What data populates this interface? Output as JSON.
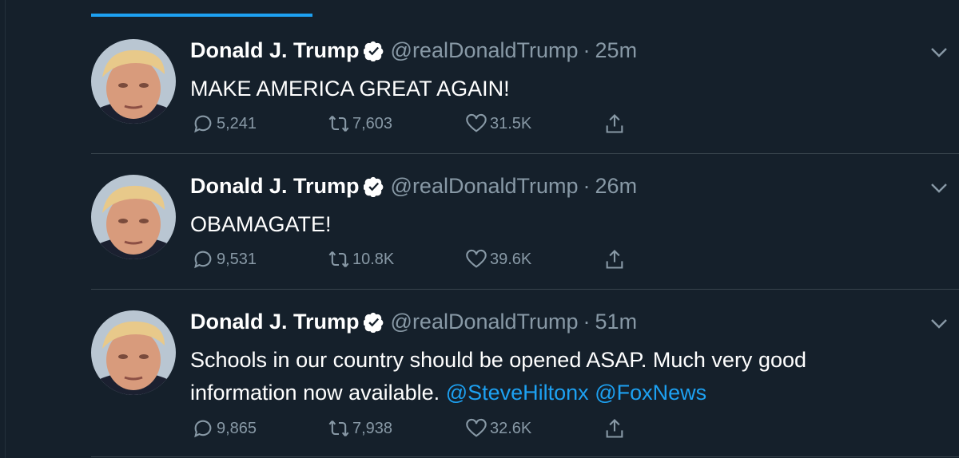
{
  "colors": {
    "background": "#15202b",
    "accent": "#1da1f2",
    "muted": "#8899a6",
    "divider": "#38444d"
  },
  "tweets": [
    {
      "name": "Donald J. Trump",
      "handle": "@realDonaldTrump",
      "separator": "·",
      "time": "25m",
      "text_parts": [
        "MAKE AMERICA GREAT AGAIN!"
      ],
      "mentions": [],
      "replies": "5,241",
      "retweets": "7,603",
      "likes": "31.5K"
    },
    {
      "name": "Donald J. Trump",
      "handle": "@realDonaldTrump",
      "separator": "·",
      "time": "26m",
      "text_parts": [
        "OBAMAGATE!"
      ],
      "mentions": [],
      "replies": "9,531",
      "retweets": "10.8K",
      "likes": "39.6K"
    },
    {
      "name": "Donald J. Trump",
      "handle": "@realDonaldTrump",
      "separator": "·",
      "time": "51m",
      "text_parts": [
        "Schools in our country should be opened ASAP. Much very good information now available."
      ],
      "mentions": [
        "@SteveHiltonx",
        "@FoxNews"
      ],
      "replies": "9,865",
      "retweets": "7,938",
      "likes": "32.6K"
    }
  ],
  "icons": {
    "verified": "verified-badge-icon",
    "caret": "chevron-down-icon",
    "reply": "reply-bubble-icon",
    "retweet": "retweet-icon",
    "like": "heart-icon",
    "share": "share-icon"
  }
}
